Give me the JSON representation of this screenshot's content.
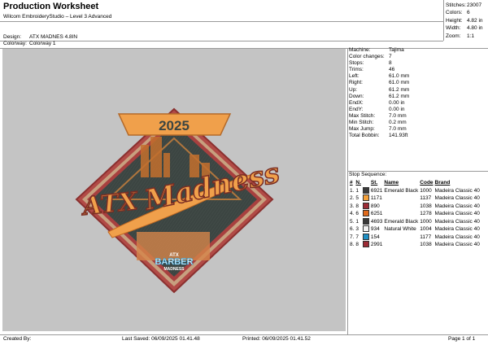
{
  "header": {
    "title": "Production Worksheet",
    "software": "Wilcom EmbroideryStudio – Level 3 Advanced",
    "design_label": "Design:",
    "design_value": "ATX MADNES 4.8IN",
    "colorway_label": "Colorway:",
    "colorway_value": "Colorway 1"
  },
  "stats": [
    {
      "label": "Stitches:",
      "value": "23007"
    },
    {
      "label": "Colors:",
      "value": "6"
    },
    {
      "label": "Height:",
      "value": "4.82 in"
    },
    {
      "label": "Width:",
      "value": "4.80 in"
    },
    {
      "label": "Zoom:",
      "value": "1:1"
    }
  ],
  "machine_info": [
    {
      "label": "Machine:",
      "value": "Tajima"
    },
    {
      "label": "Color changes:",
      "value": "7"
    },
    {
      "label": "Stops:",
      "value": "8"
    },
    {
      "label": "Trims:",
      "value": "46"
    },
    {
      "label": "Left:",
      "value": "61.0 mm"
    },
    {
      "label": "Right:",
      "value": "61.0 mm"
    },
    {
      "label": "Up:",
      "value": "61.2 mm"
    },
    {
      "label": "Down:",
      "value": "61.2 mm"
    },
    {
      "label": "EndX:",
      "value": "0.00 in"
    },
    {
      "label": "EndY:",
      "value": "0.00 in"
    },
    {
      "label": "Max Stitch:",
      "value": "7.0 mm"
    },
    {
      "label": "Min Stitch:",
      "value": "0.2 mm"
    },
    {
      "label": "Max Jump:",
      "value": "7.0 mm"
    },
    {
      "label": "Total Bobbin:",
      "value": "141.93ft"
    }
  ],
  "stop_sequence": {
    "title": "Stop Sequence:",
    "headers": [
      "#",
      "N.",
      "St.",
      "Name",
      "Code",
      "Brand"
    ],
    "rows": [
      {
        "num": "1.",
        "n": "1",
        "color": "#3a3a3a",
        "st": "6921",
        "name": "Emerald Black",
        "code": "1000",
        "brand": "Madeira Classic 40"
      },
      {
        "num": "2.",
        "n": "5",
        "color": "#f5a13a",
        "st": "1171",
        "name": "",
        "code": "1137",
        "brand": "Madeira Classic 40"
      },
      {
        "num": "3.",
        "n": "8",
        "color": "#9c2b35",
        "st": "890",
        "name": "",
        "code": "1038",
        "brand": "Madeira Classic 40"
      },
      {
        "num": "4.",
        "n": "6",
        "color": "#e06a1c",
        "st": "6251",
        "name": "",
        "code": "1278",
        "brand": "Madeira Classic 40"
      },
      {
        "num": "5.",
        "n": "1",
        "color": "#3a3a3a",
        "st": "4693",
        "name": "Emerald Black",
        "code": "1000",
        "brand": "Madeira Classic 40"
      },
      {
        "num": "6.",
        "n": "3",
        "color": "#f2f2f2",
        "st": "934",
        "name": "Natural White",
        "code": "1004",
        "brand": "Madeira Classic 40"
      },
      {
        "num": "7.",
        "n": "7",
        "color": "#1f8fc4",
        "st": "154",
        "name": "",
        "code": "1177",
        "brand": "Madeira Classic 40"
      },
      {
        "num": "8.",
        "n": "8",
        "color": "#9c2b35",
        "st": "2991",
        "name": "",
        "code": "1038",
        "brand": "Madeira Classic 40"
      }
    ]
  },
  "design": {
    "year": "2025",
    "text_atx": "ATX",
    "text_madness": "Madness",
    "badge_top": "ATX",
    "badge_main": "BARBER",
    "badge_bottom": "MADNESS"
  },
  "footer": {
    "created_by": "Created By:",
    "last_saved": "Last Saved: 06/09/2025 01.41.48",
    "printed": "Printed: 06/09/2025 01.41.52",
    "page": "Page 1 of 1"
  },
  "colors": {
    "canvas_bg": "#c4c4c4",
    "patch_border": "#a8403f",
    "patch_fill": "#3c4542",
    "accent_orange": "#f0a04b"
  }
}
